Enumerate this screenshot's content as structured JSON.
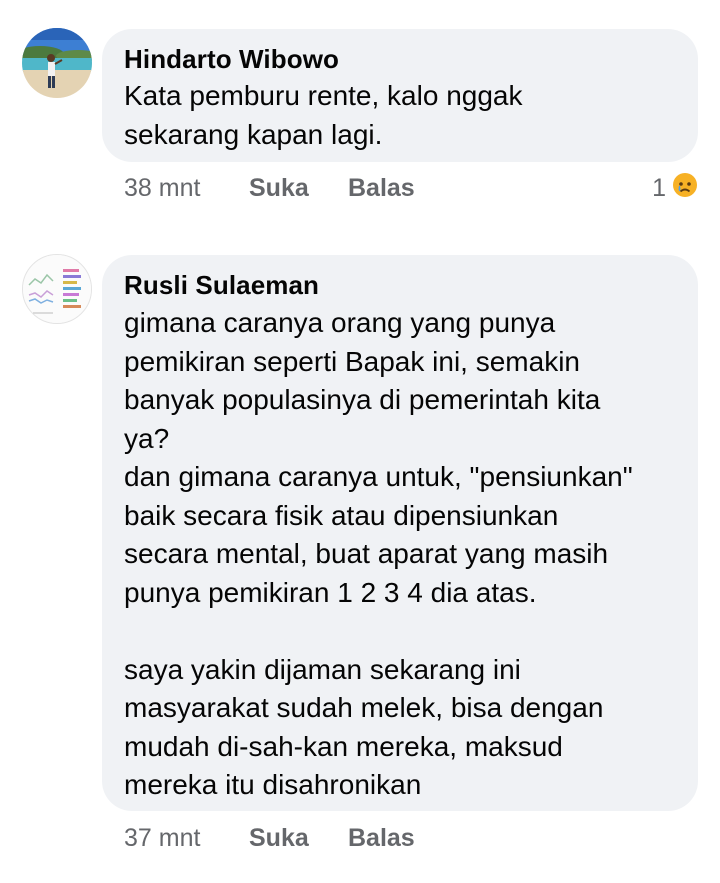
{
  "comments": [
    {
      "author": "Hindarto Wibowo",
      "text": "Kata pemburu rente, kalo nggak\nsekarang kapan lagi.",
      "time": "38 mnt",
      "like_label": "Suka",
      "reply_label": "Balas",
      "reaction_count": "1",
      "reaction_icon": "sad-face-icon"
    },
    {
      "author": "Rusli Sulaeman",
      "text": "gimana caranya orang yang punya\npemikiran seperti Bapak ini, semakin\nbanyak populasinya di pemerintah kita\nya?\ndan gimana caranya untuk, \"pensiunkan\"\nbaik secara fisik atau dipensiunkan\nsecara mental, buat aparat yang masih\npunya pemikiran 1 2 3 4 dia atas.\n\nsaya yakin dijaman sekarang ini\nmasyarakat sudah melek, bisa dengan\nmudah di-sah-kan mereka, maksud\nmereka itu disahronikan",
      "time": "37 mnt",
      "like_label": "Suka",
      "reply_label": "Balas"
    }
  ],
  "colors": {
    "bubble_bg": "#f0f2f5",
    "meta_text": "#65676b",
    "reaction_yellow": "#f7b125"
  }
}
